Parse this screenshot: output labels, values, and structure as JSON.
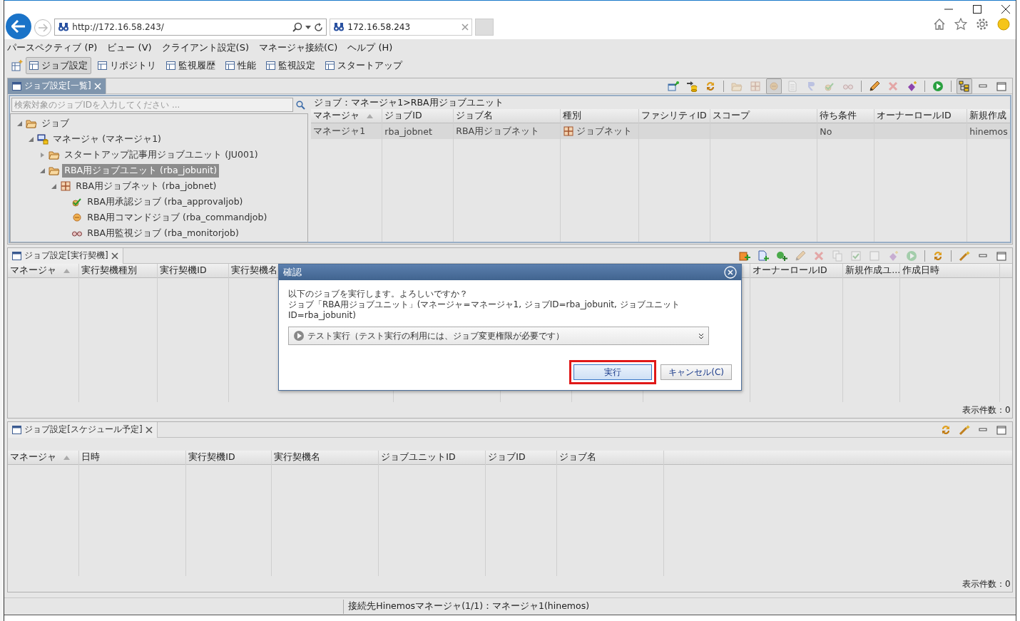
{
  "browser": {
    "address": "http://172.16.58.243/",
    "tab_title": "172.16.58.243"
  },
  "menu": [
    "パースペクティブ (P)",
    "ビュー (V)",
    "クライアント設定(S)",
    "マネージャ接続(C)",
    "ヘルプ (H)"
  ],
  "perspectives": [
    {
      "label": "ジョブ設定",
      "selected": true
    },
    {
      "label": "リポジトリ",
      "selected": false
    },
    {
      "label": "監視履歴",
      "selected": false
    },
    {
      "label": "性能",
      "selected": false
    },
    {
      "label": "監視設定",
      "selected": false
    },
    {
      "label": "スタートアップ",
      "selected": false
    }
  ],
  "job_list_view": {
    "tab": {
      "title": "ジョブ設定[一覧]",
      "active": true
    },
    "toolbar": [
      {
        "kind": "window-pin",
        "disabled": false,
        "pressed": false
      },
      {
        "kind": "database-arrow",
        "disabled": false,
        "pressed": false
      },
      {
        "kind": "refresh",
        "disabled": false,
        "pressed": false
      },
      {
        "kind": "separator"
      },
      {
        "kind": "folder",
        "disabled": true,
        "pressed": false
      },
      {
        "kind": "jobnet",
        "disabled": true,
        "pressed": false
      },
      {
        "kind": "command",
        "disabled": true,
        "pressed": true
      },
      {
        "kind": "document",
        "disabled": true,
        "pressed": false
      },
      {
        "kind": "tag",
        "disabled": true,
        "pressed": false
      },
      {
        "kind": "approval",
        "disabled": true,
        "pressed": false
      },
      {
        "kind": "monitor",
        "disabled": true,
        "pressed": false
      },
      {
        "kind": "separator"
      },
      {
        "kind": "pencil",
        "disabled": false,
        "pressed": false
      },
      {
        "kind": "delete",
        "disabled": true,
        "pressed": false
      },
      {
        "kind": "diamond",
        "disabled": false,
        "pressed": false
      },
      {
        "kind": "separator"
      },
      {
        "kind": "play",
        "disabled": false,
        "pressed": false
      },
      {
        "kind": "separator"
      },
      {
        "kind": "tree",
        "disabled": false,
        "pressed": true
      },
      {
        "kind": "minimize",
        "disabled": false,
        "pressed": false
      },
      {
        "kind": "maximize",
        "disabled": false,
        "pressed": false
      }
    ],
    "search": {
      "placeholder": "検索対象のジョブIDを入力してください ..."
    },
    "tree": [
      {
        "label": "ジョブ",
        "kind": "folder",
        "expanded": true,
        "selected": false,
        "children": [
          {
            "label": "マネージャ (マネージャ1)",
            "kind": "manager",
            "expanded": true,
            "selected": false,
            "children": [
              {
                "label": "スタートアップ記事用ジョブユニット (JU001)",
                "kind": "folder",
                "expanded": false,
                "selected": false
              },
              {
                "label": "RBA用ジョブユニット (rba_jobunit)",
                "kind": "folder",
                "expanded": true,
                "selected": true,
                "children": [
                  {
                    "label": "RBA用ジョブネット (rba_jobnet)",
                    "kind": "jobnet",
                    "expanded": true,
                    "selected": false,
                    "children": [
                      {
                        "label": "RBA用承認ジョブ (rba_approvaljob)",
                        "kind": "approval",
                        "selected": false
                      },
                      {
                        "label": "RBA用コマンドジョブ (rba_commandjob)",
                        "kind": "command",
                        "selected": false
                      },
                      {
                        "label": "RBA用監視ジョブ (rba_monitorjob)",
                        "kind": "monitor",
                        "selected": false
                      }
                    ]
                  }
                ]
              }
            ]
          }
        ]
      }
    ],
    "breadcrumb": "ジョブ：マネージャ1>RBA用ジョブユニット",
    "table": {
      "columns": [
        {
          "label": "マネージャ",
          "sorted": true
        },
        {
          "label": "ジョブID",
          "sorted": false
        },
        {
          "label": "ジョブ名",
          "sorted": false
        },
        {
          "label": "種別",
          "sorted": false
        },
        {
          "label": "ファシリティID",
          "sorted": false
        },
        {
          "label": "スコープ",
          "sorted": false
        },
        {
          "label": "待ち条件",
          "sorted": false
        },
        {
          "label": "オーナーロールID",
          "sorted": false
        },
        {
          "label": "新規作成",
          "sorted": false
        }
      ],
      "rows": [
        {
          "selected": true,
          "cells": [
            {
              "text": "マネージャ1"
            },
            {
              "text": "rba_jobnet"
            },
            {
              "text": "RBA用ジョブネット"
            },
            {
              "text": "ジョブネット",
              "kind": "jobnet"
            },
            {},
            {},
            {
              "text": "No"
            },
            {},
            {
              "text": "hinemos"
            }
          ]
        }
      ]
    }
  },
  "trigger_view": {
    "tab": {
      "title": "ジョブ設定[実行契機]",
      "active": false
    },
    "toolbar": [
      {
        "kind": "add-schedule",
        "disabled": false,
        "pressed": false
      },
      {
        "kind": "add-file",
        "disabled": false,
        "pressed": false
      },
      {
        "kind": "add-manual",
        "disabled": false,
        "pressed": false
      },
      {
        "kind": "pencil",
        "disabled": true,
        "pressed": false
      },
      {
        "kind": "delete",
        "disabled": true,
        "pressed": false
      },
      {
        "kind": "copy",
        "disabled": true,
        "pressed": false
      },
      {
        "kind": "checkbox-checked",
        "disabled": true,
        "pressed": false
      },
      {
        "kind": "checkbox",
        "disabled": true,
        "pressed": false
      },
      {
        "kind": "diamond",
        "disabled": true,
        "pressed": false
      },
      {
        "kind": "play",
        "disabled": true,
        "pressed": false
      },
      {
        "kind": "separator"
      },
      {
        "kind": "refresh",
        "disabled": false,
        "pressed": false
      },
      {
        "kind": "separator"
      },
      {
        "kind": "wand",
        "disabled": false,
        "pressed": false
      },
      {
        "kind": "minimize",
        "disabled": false,
        "pressed": false
      },
      {
        "kind": "maximize",
        "disabled": false,
        "pressed": false
      }
    ],
    "table": {
      "columns": [
        {
          "label": "マネージャ",
          "sorted": true
        },
        {
          "label": "実行契機種別",
          "sorted": false
        },
        {
          "label": "実行契機ID",
          "sorted": false
        },
        {
          "label": "実行契機名",
          "sorted": false
        },
        {
          "label": "オーナーロールID",
          "sorted": false
        },
        {
          "label": "新規作成ユ...",
          "sorted": false
        },
        {
          "label": "作成日時",
          "sorted": false
        }
      ]
    },
    "count": "表示件数：0"
  },
  "schedule_view": {
    "tab": {
      "title": "ジョブ設定[スケジュール予定]",
      "active": false
    },
    "toolbar": [
      {
        "kind": "refresh",
        "disabled": false,
        "pressed": false
      },
      {
        "kind": "wand",
        "disabled": false,
        "pressed": false
      },
      {
        "kind": "minimize",
        "disabled": false,
        "pressed": false
      },
      {
        "kind": "maximize",
        "disabled": false,
        "pressed": false
      }
    ],
    "table": {
      "columns": [
        {
          "label": "マネージャ",
          "sorted": true
        },
        {
          "label": "日時",
          "sorted": false
        },
        {
          "label": "実行契機ID",
          "sorted": false
        },
        {
          "label": "実行契機名",
          "sorted": false
        },
        {
          "label": "ジョブユニットID",
          "sorted": false
        },
        {
          "label": "ジョブID",
          "sorted": false
        },
        {
          "label": "ジョブ名",
          "sorted": false
        }
      ]
    },
    "count": "表示件数：0"
  },
  "dialog": {
    "title": "確認",
    "message": [
      "以下のジョブを実行します。よろしいですか？",
      "ジョブ「RBA用ジョブユニット」(マネージャ=マネージャ1, ジョブID=rba_jobunit, ジョブユニットID=rba_jobunit)"
    ],
    "mode": {
      "value": "テスト実行（テスト実行の利用には、ジョブ変更権限が必要です）"
    },
    "buttons": [
      {
        "label": "実行",
        "highlighted": true
      },
      {
        "label": "キャンセル(C)",
        "highlighted": false
      }
    ]
  },
  "status_bar": "接続先Hinemosマネージャ(1/1)：マネージャ1(hinemos)"
}
